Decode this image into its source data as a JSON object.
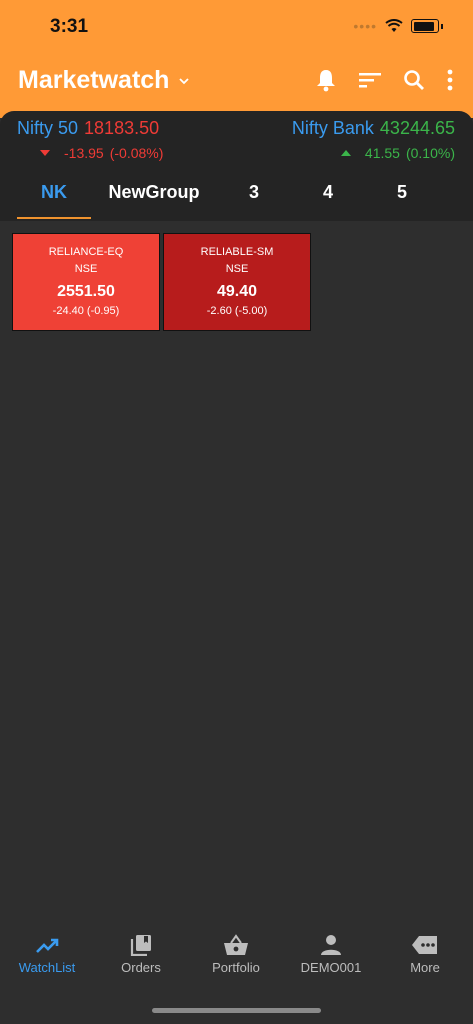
{
  "status_bar": {
    "time": "3:31"
  },
  "header": {
    "title": "Marketwatch"
  },
  "indices": {
    "left": {
      "name": "Nifty 50",
      "value": "18183.50",
      "change": "-13.95",
      "percent": "(-0.08%)"
    },
    "right": {
      "name": "Nifty Bank",
      "value": "43244.65",
      "change": "41.55",
      "percent": "(0.10%)"
    }
  },
  "tabs": [
    {
      "label": "NK"
    },
    {
      "label": "NewGroup"
    },
    {
      "label": "3"
    },
    {
      "label": "4"
    },
    {
      "label": "5"
    }
  ],
  "watchlist": [
    {
      "symbol": "RELIANCE-EQ",
      "exchange": "NSE",
      "ltp": "2551.50",
      "change": "-24.40 (-0.95)",
      "color": "#ef4136"
    },
    {
      "symbol": "RELIABLE-SM",
      "exchange": "NSE",
      "ltp": "49.40",
      "change": "-2.60 (-5.00)",
      "color": "#b71c1c"
    }
  ],
  "bottom_nav": [
    {
      "label": "WatchList",
      "icon": "trending-up-icon"
    },
    {
      "label": "Orders",
      "icon": "orders-icon"
    },
    {
      "label": "Portfolio",
      "icon": "basket-icon"
    },
    {
      "label": "DEMO001",
      "icon": "person-icon"
    },
    {
      "label": "More",
      "icon": "more-icon"
    }
  ],
  "colors": {
    "header": "#ff9a36",
    "accent": "#3a9bef",
    "loss": "#ef3b36",
    "gain": "#3bb54a"
  }
}
